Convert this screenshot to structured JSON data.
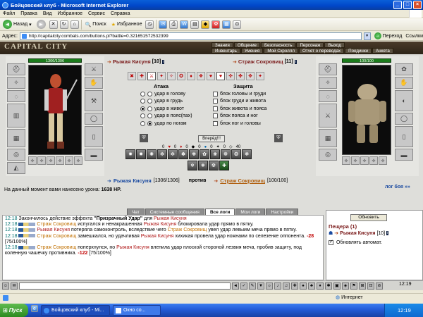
{
  "window": {
    "title": "Бойцовский клуб - Microsoft Internet Explorer"
  },
  "menu": [
    "Файл",
    "Правка",
    "Вид",
    "Избранное",
    "Сервис",
    "Справка"
  ],
  "toolbar": {
    "back": "Назад",
    "search": "Поиск",
    "favorites": "Избранное"
  },
  "address": {
    "label": "Адрес:",
    "url": "http://capitalcity.combats.com/buttons.pl?battle=0.321651572532399",
    "go": "Переход",
    "links": "Ссылки"
  },
  "game": {
    "logo": "CAPITAL CITY",
    "nav_top": [
      "Знания",
      "Общение",
      "Безопасность",
      "Персонаж",
      "Выход"
    ],
    "nav_bottom": [
      "Инвентарь",
      "Умения",
      "Мой Скроллл",
      "Отчет о переводах",
      "Поединки",
      "Анкета"
    ],
    "player": {
      "name": "Рыжая Кисуня",
      "level": "[10]",
      "hp": "1306/1306",
      "hp_full": "[1306/1306]"
    },
    "enemy": {
      "name": "Страж Сокровищ",
      "level": "[11]",
      "hp": "100/100",
      "hp_full": "[100/100]"
    },
    "attack_title": "Атака",
    "defense_title": "Защита",
    "attacks": [
      "удар в голову",
      "удар в грудь",
      "удар в живот",
      "удар в пояс(пах)",
      "удар по ногам"
    ],
    "blocks": [
      "блок головы и груди",
      "блок груди и живота",
      "блок живота и пояса",
      "блок пояса и ног",
      "блок ног и головы"
    ],
    "forward_button": "Вперёд!!!",
    "counters": [
      "0",
      "0",
      "0",
      "0",
      "0",
      "0",
      "40"
    ],
    "versus": "против",
    "damage_text": "На данный момент вами нанесено урона:",
    "damage_value": "1638 HP.",
    "battle_log_link": "лог боя »»"
  },
  "log_tabs": [
    "Чат",
    "Системные сообщения",
    "Все логи",
    "Мои логи",
    "Настройки"
  ],
  "log": [
    {
      "time": "12:18",
      "html": "Закончилось действие эффекта <span class='b'>\"Призрачный Удар\"</span> для <span class='p'>Рыжая Кисуня</span>"
    },
    {
      "time": "12:18",
      "html": "<span class='blk'></span> <span class='e'>Страж Сокровищ</span> испугался и ненакрашенная <span class='p'>Рыжая Кисуня</span> блокировала удар прямо в пятку."
    },
    {
      "time": "12:18",
      "html": "<span class='blk'></span> <span class='p'>Рыжая Кисуня</span> потеряла самоконтроль, вследствие чего <span class='e'>Страж Сокровищ</span> увел удар левыим меча прямо в пятку."
    },
    {
      "time": "12:18",
      "html": "<span class='blk'></span> <span class='e'>Страж Сокровищ</span> замешкался, но удачливая <span class='p'>Рыжая Кисуня</span> хихикая провела удар ножнами по селезенке оппонента. <span class='dmg'>-28</span> [75/100%]"
    },
    {
      "time": "12:18",
      "html": "<span class='blk'></span> <span class='e'>Страж Сокровищ</span> поперхнулся, но <span class='p'>Рыжая Кисуня</span> влепила удар плоской стороной лезвия меча, пробив защиту, под коленную чашечку противника. <span class='dmg'>-122</span> [75/100%]"
    }
  ],
  "right_panel": {
    "refresh": "Обновить",
    "location": "Пещера (1)",
    "member": "Рыжая Кисуня",
    "member_level": "[10]",
    "auto_refresh": "Обновлять автомат."
  },
  "status": {
    "zone": "Интернет"
  },
  "taskbar": {
    "start": "Пуск",
    "tasks": [
      "Бойцовский клуб - Mi...",
      "Окно со..."
    ],
    "clock": "12:19"
  }
}
